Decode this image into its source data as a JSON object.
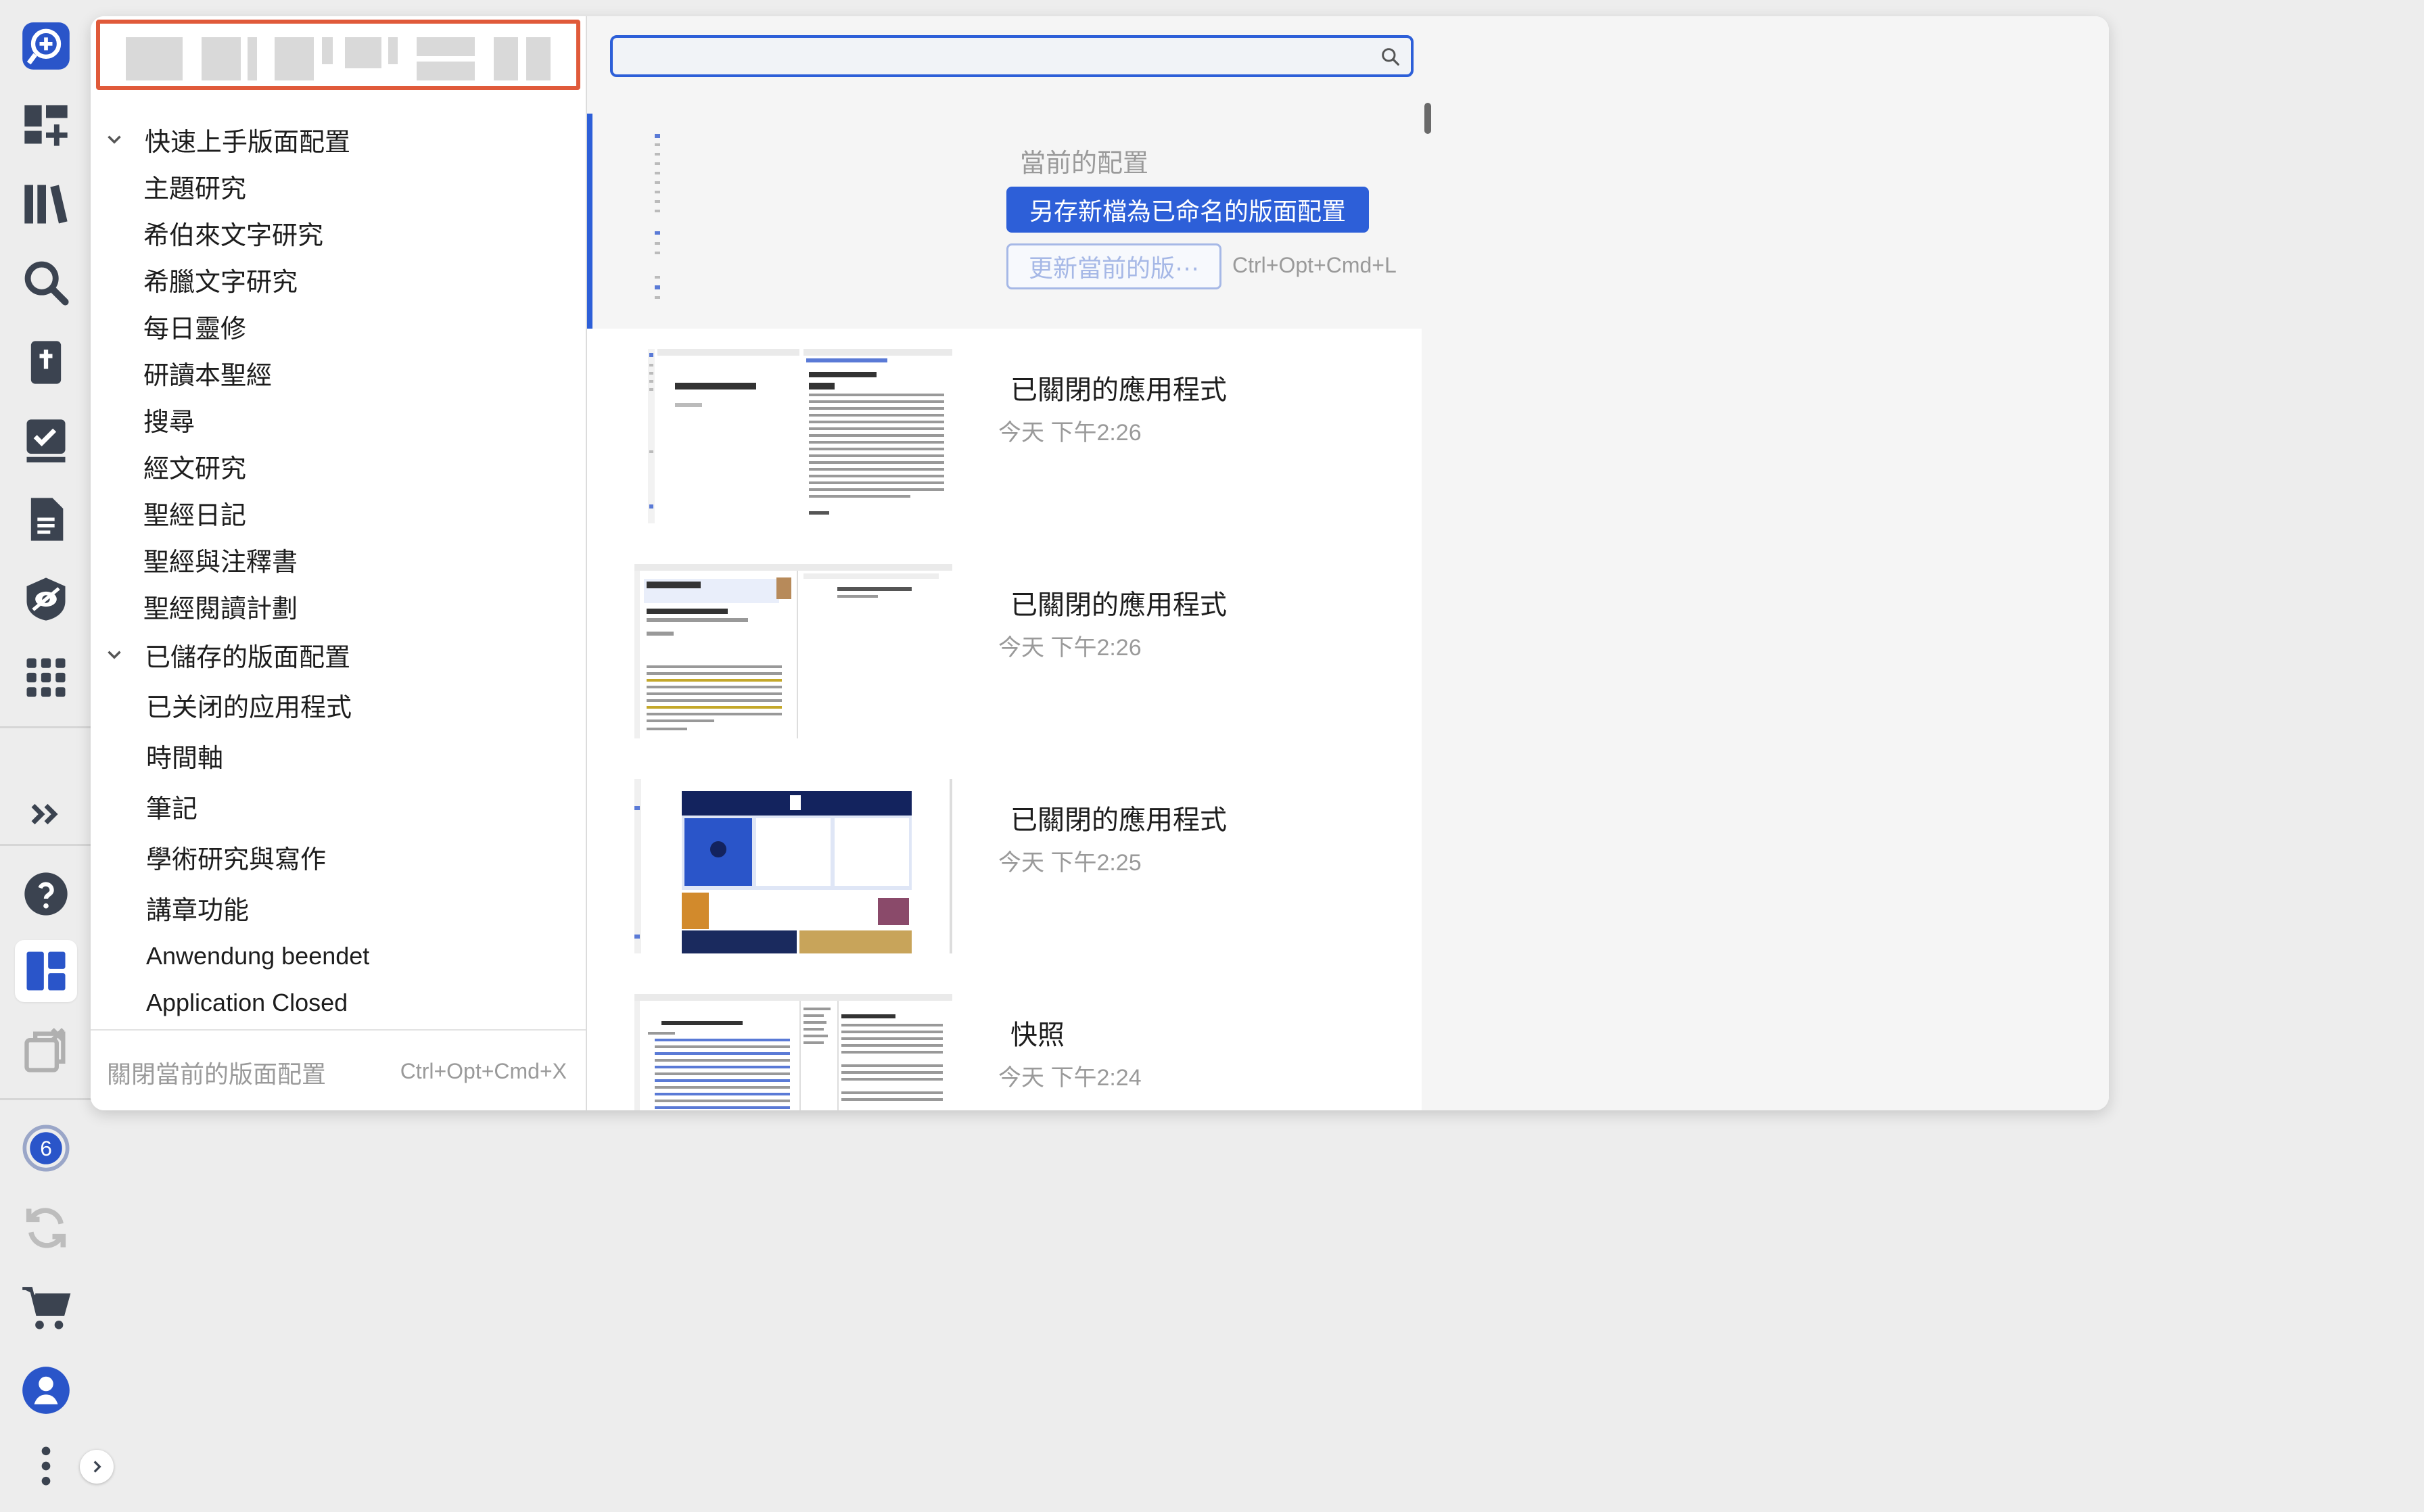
{
  "colors": {
    "accent": "#2d5fd8",
    "highlight_border": "#e05a3a",
    "muted_text": "#9a9a9a"
  },
  "sidebar": {
    "icons": [
      "add-search-icon",
      "dashboard-add-icon",
      "library-icon",
      "search-icon",
      "bible-icon",
      "checklist-icon",
      "document-icon",
      "privacy-eye-icon",
      "apps-grid-icon",
      "expand-icon",
      "help-icon",
      "layouts-icon",
      "closed-windows-icon",
      "notification-icon",
      "sync-icon",
      "cart-icon",
      "user-icon",
      "more-icon"
    ],
    "notification_count": "6"
  },
  "tree": {
    "groups": [
      {
        "label": "快速上手版面配置",
        "items": [
          "主題研究",
          "希伯來文字研究",
          "希臘文字研究",
          "每日靈修",
          "研讀本聖經",
          "搜尋",
          "經文研究",
          "聖經日記",
          "聖經與注釋書",
          "聖經閱讀計劃"
        ]
      },
      {
        "label": "已儲存的版面配置",
        "items": [
          "已关闭的应用程式",
          "時間軸",
          "筆記",
          "學術研究與寫作",
          "講章功能",
          "Anwendung beendet",
          "Application Closed"
        ]
      }
    ]
  },
  "footer": {
    "close_label": "關閉當前的版面配置",
    "close_shortcut": "Ctrl+Opt+Cmd+X"
  },
  "search": {
    "value": "",
    "placeholder": ""
  },
  "current": {
    "label": "當前的配置",
    "save_button": "另存新檔為已命名的版面配置",
    "update_button": "更新當前的版⋯",
    "update_shortcut": "Ctrl+Opt+Cmd+L"
  },
  "layouts": [
    {
      "title": "已關閉的應用程式",
      "time": "今天 下午2:26"
    },
    {
      "title": "已關閉的應用程式",
      "time": "今天 下午2:26"
    },
    {
      "title": "已關閉的應用程式",
      "time": "今天 下午2:25"
    },
    {
      "title": "快照",
      "time": "今天 下午2:24"
    }
  ]
}
